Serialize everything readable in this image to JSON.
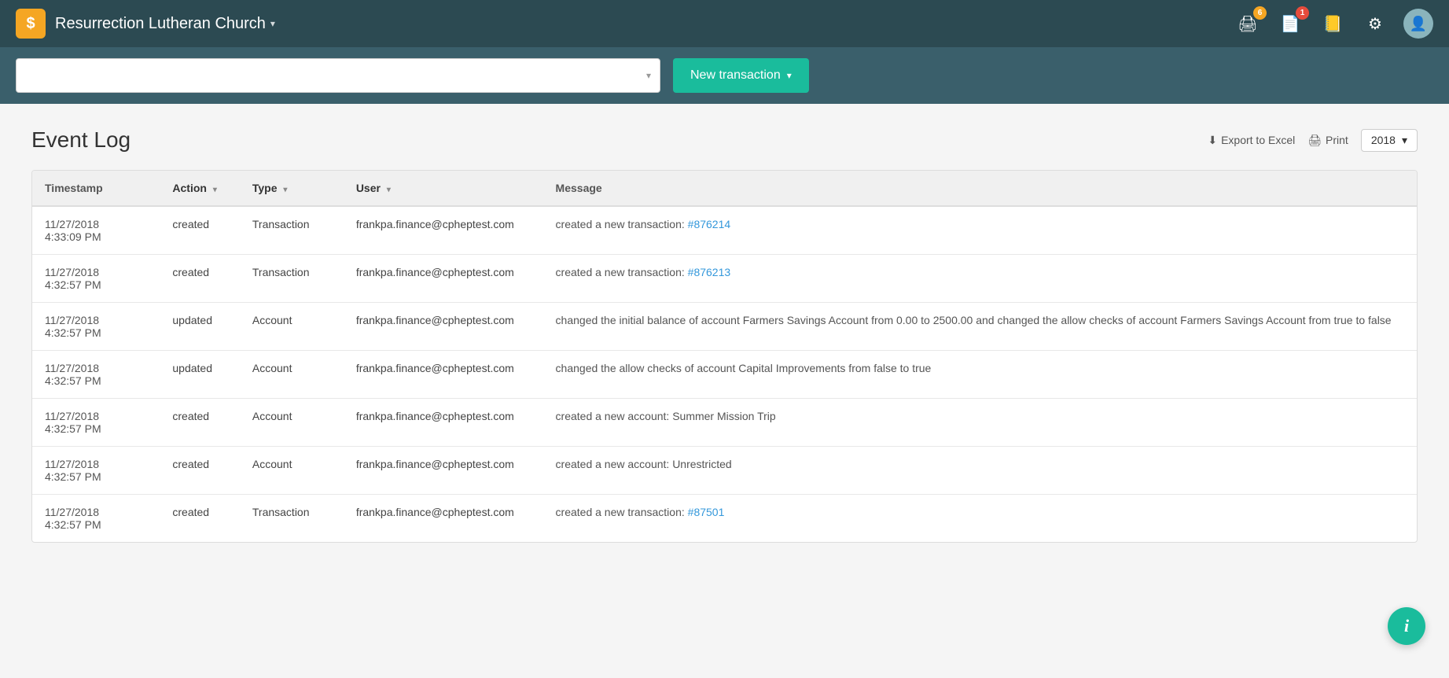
{
  "header": {
    "org_name": "Resurrection Lutheran Church",
    "org_chevron": "▾",
    "logo_symbol": "$",
    "icons": {
      "print_badge": "6",
      "doc_badge": "1"
    }
  },
  "sub_header": {
    "search_placeholder": "",
    "new_transaction_label": "New transaction",
    "new_transaction_chevron": "▾"
  },
  "page": {
    "title": "Event Log",
    "export_label": "Export to Excel",
    "print_label": "Print",
    "year_label": "2018",
    "year_chevron": "▾"
  },
  "table": {
    "columns": [
      {
        "label": "Timestamp",
        "sortable": false
      },
      {
        "label": "Action",
        "sortable": true
      },
      {
        "label": "Type",
        "sortable": true
      },
      {
        "label": "User",
        "sortable": true
      },
      {
        "label": "Message",
        "sortable": false
      }
    ],
    "rows": [
      {
        "timestamp": "11/27/2018\n4:33:09 PM",
        "action": "created",
        "type": "Transaction",
        "user": "frankpa.finance@cpheptest.com",
        "message_text": "created a new transaction: ",
        "message_link": "#876214",
        "message_link_href": "#876214"
      },
      {
        "timestamp": "11/27/2018\n4:32:57 PM",
        "action": "created",
        "type": "Transaction",
        "user": "frankpa.finance@cpheptest.com",
        "message_text": "created a new transaction: ",
        "message_link": "#876213",
        "message_link_href": "#876213"
      },
      {
        "timestamp": "11/27/2018\n4:32:57 PM",
        "action": "updated",
        "type": "Account",
        "user": "frankpa.finance@cpheptest.com",
        "message_text": "changed the initial balance of account Farmers Savings Account from 0.00 to 2500.00 and changed the allow checks of account Farmers Savings Account from true to false",
        "message_link": "",
        "message_link_href": ""
      },
      {
        "timestamp": "11/27/2018\n4:32:57 PM",
        "action": "updated",
        "type": "Account",
        "user": "frankpa.finance@cpheptest.com",
        "message_text": "changed the allow checks of account Capital Improvements from false to true",
        "message_link": "",
        "message_link_href": ""
      },
      {
        "timestamp": "11/27/2018\n4:32:57 PM",
        "action": "created",
        "type": "Account",
        "user": "frankpa.finance@cpheptest.com",
        "message_text": "created a new account: Summer Mission Trip",
        "message_link": "",
        "message_link_href": ""
      },
      {
        "timestamp": "11/27/2018\n4:32:57 PM",
        "action": "created",
        "type": "Account",
        "user": "frankpa.finance@cpheptest.com",
        "message_text": "created a new account: Unrestricted",
        "message_link": "",
        "message_link_href": ""
      },
      {
        "timestamp": "11/27/2018\n4:32:57 PM",
        "action": "created",
        "type": "Transaction",
        "user": "frankpa.finance@cpheptest.com",
        "message_text": "created a new transaction: ",
        "message_link": "#87501",
        "message_link_href": "#87501"
      }
    ]
  },
  "fab": {
    "icon": "i"
  }
}
